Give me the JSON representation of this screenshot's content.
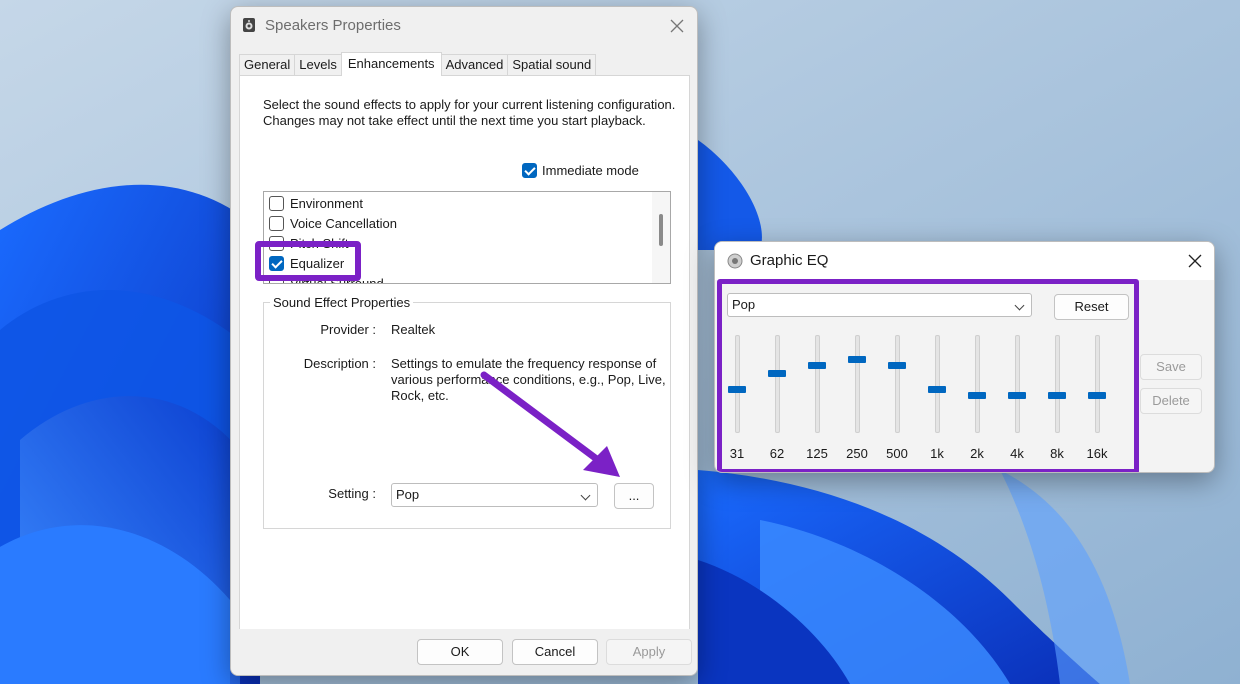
{
  "speakers_window": {
    "title": "Speakers Properties",
    "tabs": [
      "General",
      "Levels",
      "Enhancements",
      "Advanced",
      "Spatial sound"
    ],
    "active_tab": "Enhancements",
    "description": "Select the sound effects to apply for your current listening configuration. Changes may not take effect until the next time you start playback.",
    "immediate_mode_label": "Immediate mode",
    "immediate_mode_checked": true,
    "effects": [
      {
        "label": "Environment",
        "checked": false
      },
      {
        "label": "Voice Cancellation",
        "checked": false
      },
      {
        "label": "Pitch Shift",
        "checked": false
      },
      {
        "label": "Equalizer",
        "checked": true
      },
      {
        "label": "Virtual Surround",
        "checked": false
      }
    ],
    "group_title": "Sound Effect Properties",
    "provider_label": "Provider :",
    "provider_value": "Realtek",
    "description_label": "Description :",
    "description_value": "Settings to emulate the frequency response of various performance conditions,  e.g., Pop, Live, Rock, etc.",
    "setting_label": "Setting :",
    "setting_value": "Pop",
    "more_button": "...",
    "ok_button": "OK",
    "cancel_button": "Cancel",
    "apply_button": "Apply"
  },
  "eq_window": {
    "title": "Graphic EQ",
    "preset_value": "Pop",
    "reset_button": "Reset",
    "save_button": "Save",
    "delete_button": "Delete",
    "bands": [
      {
        "label": "31",
        "level": 0.45
      },
      {
        "label": "62",
        "level": 0.61
      },
      {
        "label": "125",
        "level": 0.69
      },
      {
        "label": "250",
        "level": 0.76
      },
      {
        "label": "500",
        "level": 0.69
      },
      {
        "label": "1k",
        "level": 0.45
      },
      {
        "label": "2k",
        "level": 0.39
      },
      {
        "label": "4k",
        "level": 0.39
      },
      {
        "label": "8k",
        "level": 0.39
      },
      {
        "label": "16k",
        "level": 0.39
      }
    ]
  },
  "colors": {
    "accent": "#0067c0",
    "annotation": "#7b21c6"
  }
}
